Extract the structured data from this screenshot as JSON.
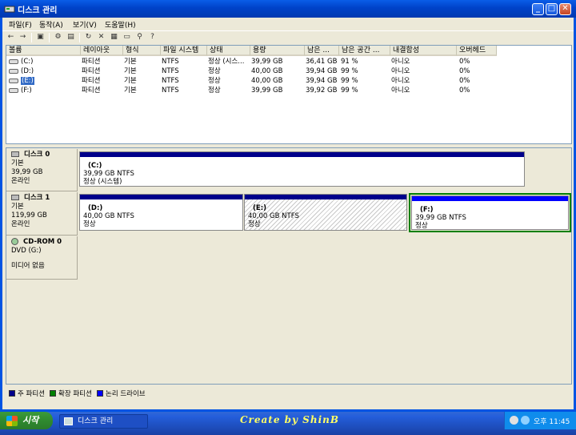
{
  "window": {
    "title": "디스크 관리"
  },
  "title_buttons": {
    "minimize": "_",
    "maximize": "□",
    "close": "✕"
  },
  "menu": [
    "파일(F)",
    "동작(A)",
    "보기(V)",
    "도움말(H)"
  ],
  "toolbar_icons": [
    "back-icon",
    "forward-icon",
    "view-icon",
    "properties-icon",
    "view-list-icon",
    "refresh-icon",
    "delete-icon",
    "properties-sheet-icon",
    "open-icon",
    "search-icon",
    "help-icon"
  ],
  "list": {
    "columns": [
      "볼륨",
      "레이아웃",
      "형식",
      "파일 시스템",
      "상태",
      "용량",
      "남은 ...",
      "남은 공간 ...",
      "내결함성",
      "오버헤드"
    ],
    "rows": [
      [
        "(C:)",
        "파티션",
        "기본",
        "NTFS",
        "정상 (시스...",
        "39,99 GB",
        "36,41 GB",
        "91 %",
        "아니오",
        "0%"
      ],
      [
        "(D:)",
        "파티션",
        "기본",
        "NTFS",
        "정상",
        "40,00 GB",
        "39,94 GB",
        "99 %",
        "아니오",
        "0%"
      ],
      [
        "(E:)",
        "파티션",
        "기본",
        "NTFS",
        "정상",
        "40,00 GB",
        "39,94 GB",
        "99 %",
        "아니오",
        "0%"
      ],
      [
        "(F:)",
        "파티션",
        "기본",
        "NTFS",
        "정상",
        "39,99 GB",
        "39,92 GB",
        "99 %",
        "아니오",
        "0%"
      ]
    ],
    "selected_volume": "(E:)"
  },
  "disks": [
    {
      "name": "디스크 0",
      "type": "기본",
      "size": "39,99 GB",
      "status": "온라인",
      "partitions": [
        {
          "letter": "(C:)",
          "info": "39,99 GB NTFS",
          "status": "정상 (시스템)"
        }
      ]
    },
    {
      "name": "디스크 1",
      "type": "기본",
      "size": "119,99 GB",
      "status": "온라인",
      "partitions": [
        {
          "letter": "(D:)",
          "info": "40,00 GB NTFS",
          "status": "정상"
        },
        {
          "letter": "(E:)",
          "info": "40,00 GB NTFS",
          "status": "정상"
        },
        {
          "letter": "(F:)",
          "info": "39,99 GB NTFS",
          "status": "정상"
        }
      ]
    },
    {
      "name": "CD-ROM 0",
      "type": "DVD (G:)",
      "size": "",
      "status": "미디어 없음",
      "partitions": []
    }
  ],
  "legend": [
    {
      "label": "주 파티션",
      "color": "#00008b"
    },
    {
      "label": "확장 파티션",
      "color": "#008000"
    },
    {
      "label": "논리 드라이브",
      "color": "#0000ff"
    }
  ],
  "taskbar": {
    "start_label": "시작",
    "task_label": "디스크 관리",
    "credit": "Create by ShinB",
    "clock": "오후 11:45"
  },
  "colors": {
    "primary_partition": "#00008b",
    "extended_partition": "#008000",
    "logical_drive": "#0000ff",
    "title_blue": "#0054e3"
  }
}
